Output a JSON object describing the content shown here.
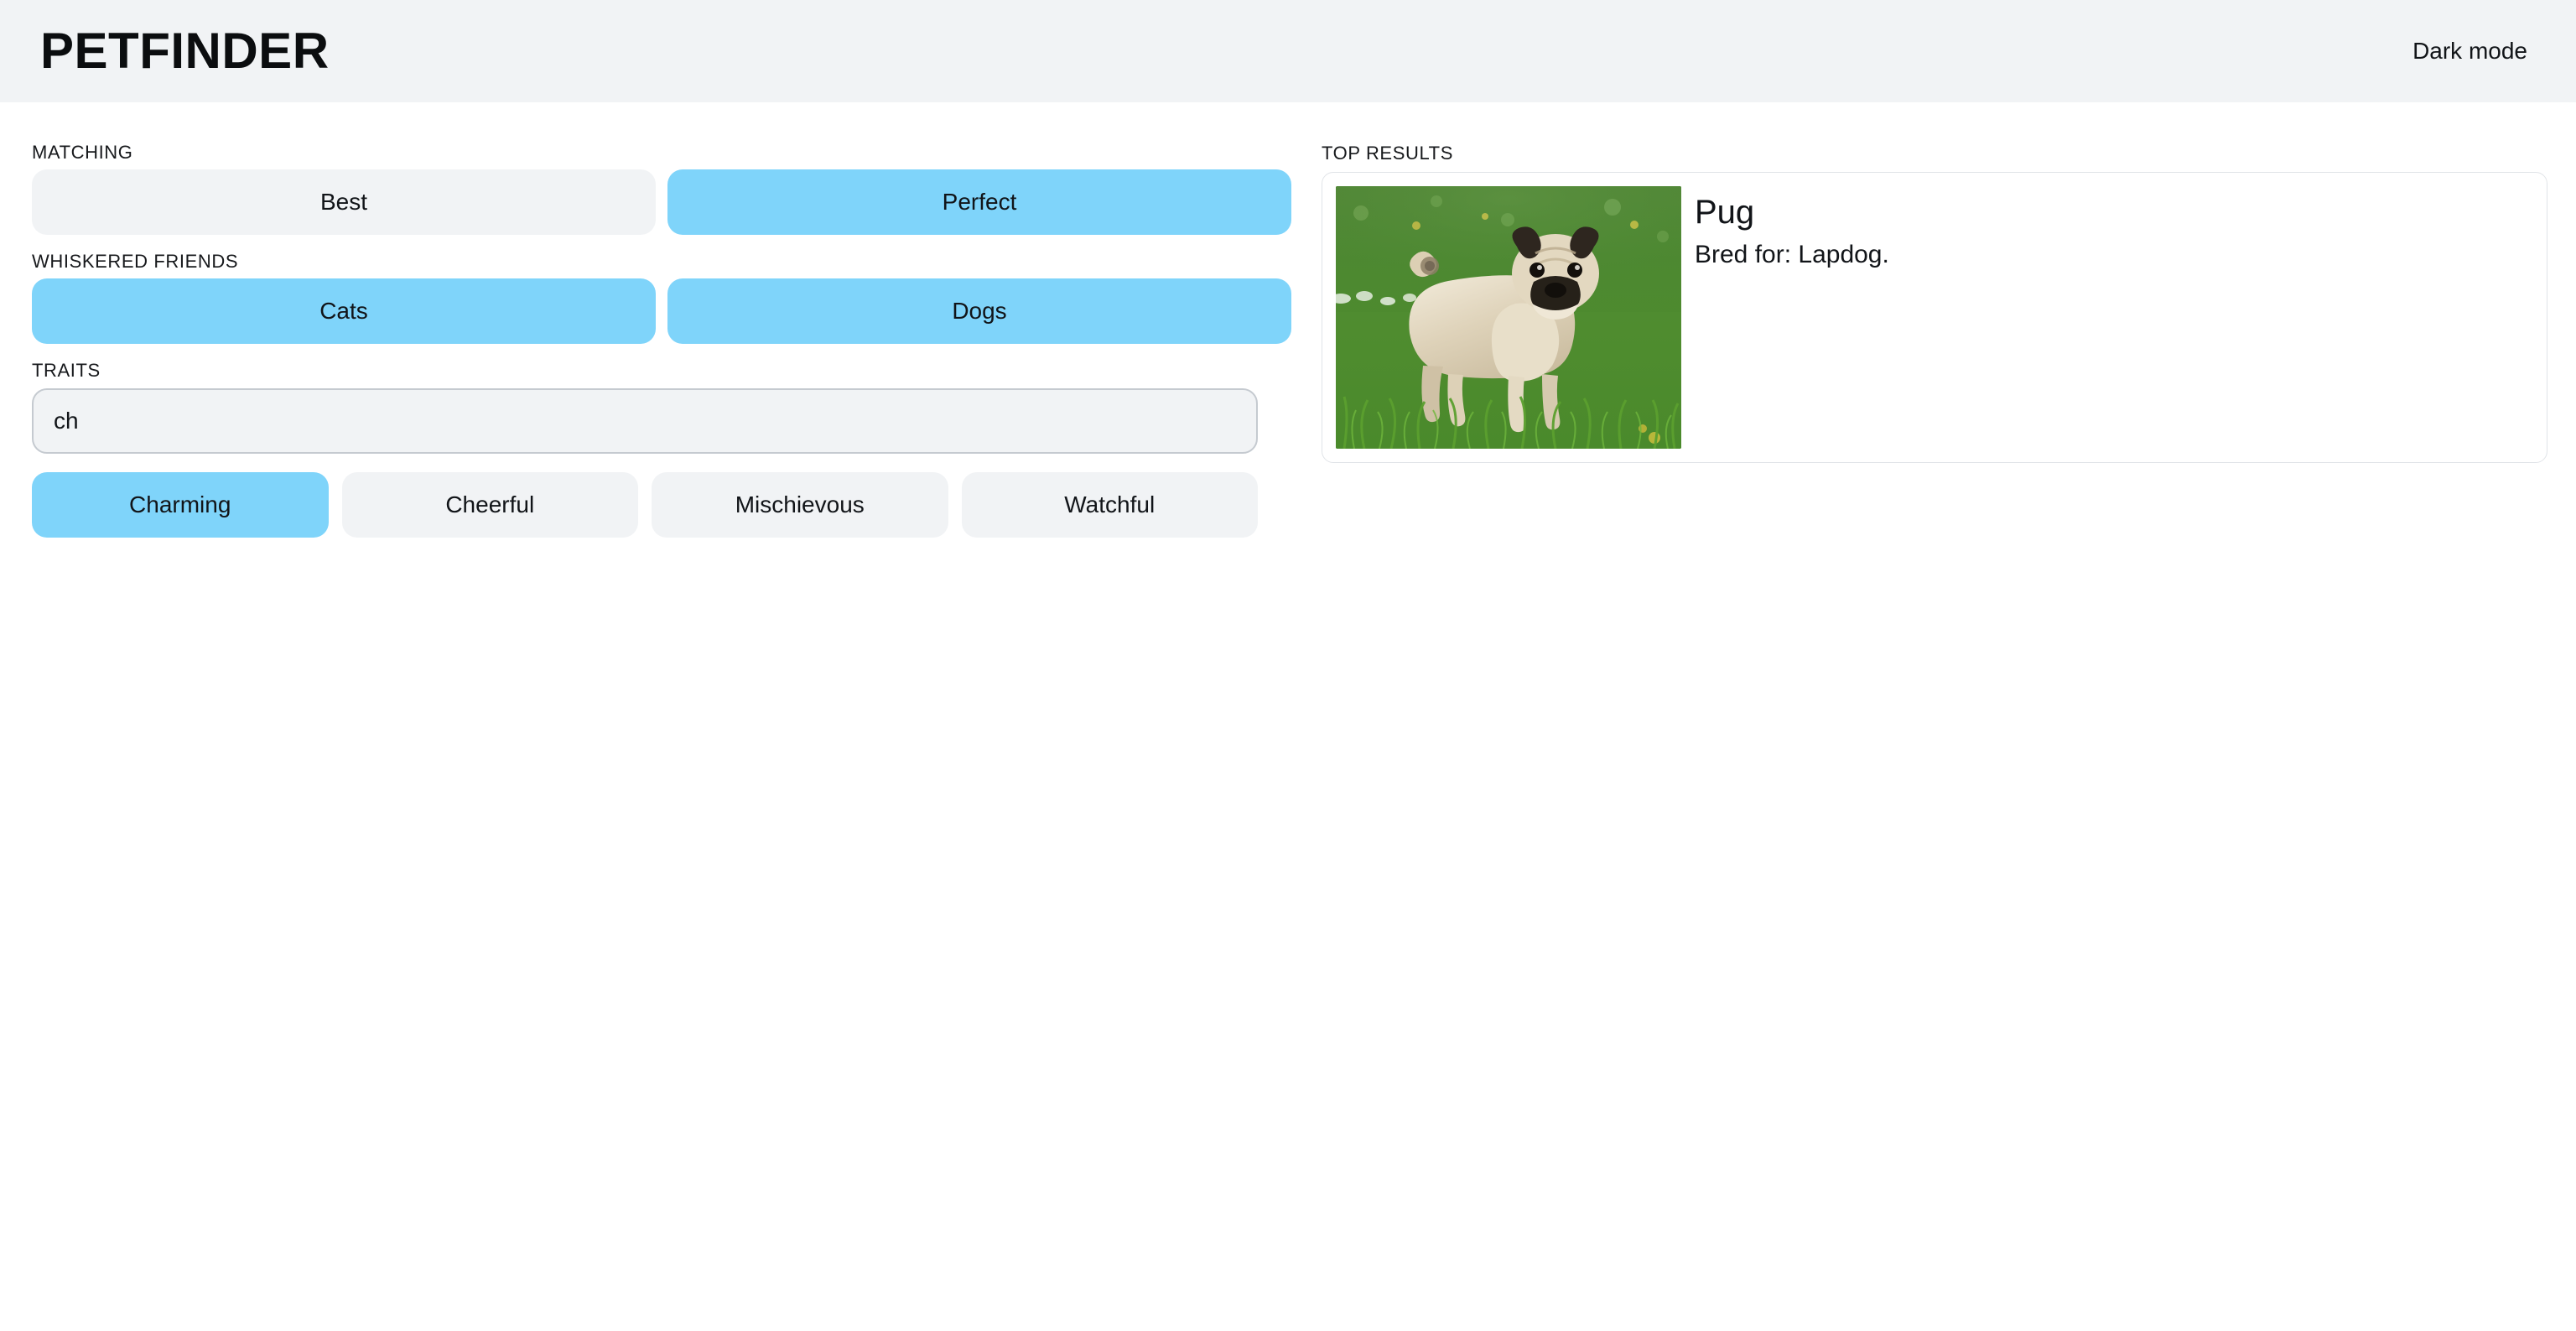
{
  "header": {
    "brand": "PETFINDER",
    "dark_mode_label": "Dark mode",
    "background_color": "#F1F3F5"
  },
  "theme": {
    "accent_selected": "#7FD4FA",
    "surface_muted": "#F1F3F5",
    "border_color": "#C5CAD0",
    "card_border": "#E1E4E8",
    "text_color": "#111418",
    "page_background": "#FFFFFF"
  },
  "filters": {
    "matching": {
      "label": "MATCHING",
      "options": [
        {
          "label": "Best",
          "selected": false
        },
        {
          "label": "Perfect",
          "selected": true
        }
      ]
    },
    "whiskered_friends": {
      "label": "WHISKERED FRIENDS",
      "options": [
        {
          "label": "Cats",
          "selected": true
        },
        {
          "label": "Dogs",
          "selected": true
        }
      ]
    },
    "traits": {
      "label": "TRAITS",
      "search": {
        "value": "ch",
        "placeholder": ""
      },
      "chips": [
        {
          "label": "Charming",
          "selected": true
        },
        {
          "label": "Cheerful",
          "selected": false
        },
        {
          "label": "Mischievous",
          "selected": false
        },
        {
          "label": "Watchful",
          "selected": false
        }
      ]
    }
  },
  "results": {
    "label": "TOP RESULTS",
    "items": [
      {
        "name": "Pug",
        "description": "Bred for: Lapdog.",
        "photo_alt": "pug-standing-in-grass-photo"
      }
    ]
  }
}
